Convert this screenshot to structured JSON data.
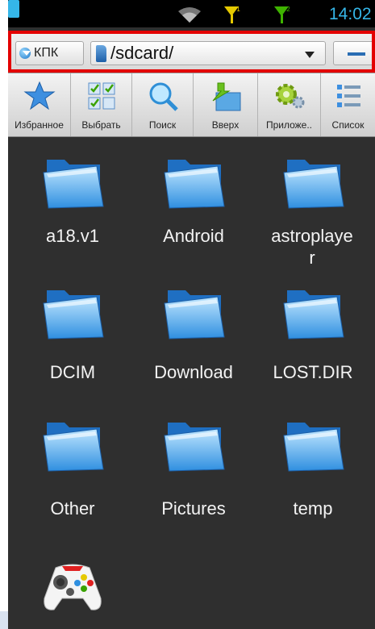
{
  "status_bar": {
    "time": "14:02"
  },
  "path_bar": {
    "kpk_label": "КПК",
    "path": "/sdcard/"
  },
  "toolbar": {
    "items": [
      {
        "label": "Избранное",
        "icon": "star-icon"
      },
      {
        "label": "Выбрать",
        "icon": "select-grid-icon"
      },
      {
        "label": "Поиск",
        "icon": "search-icon"
      },
      {
        "label": "Вверх",
        "icon": "folder-up-icon"
      },
      {
        "label": "Приложе..",
        "icon": "gear-icon"
      },
      {
        "label": "Список",
        "icon": "list-icon"
      }
    ]
  },
  "files": [
    {
      "name": "a18.v1",
      "type": "folder"
    },
    {
      "name": "Android",
      "type": "folder"
    },
    {
      "name": "astroplaye\nr",
      "type": "folder"
    },
    {
      "name": "DCIM",
      "type": "folder"
    },
    {
      "name": "Download",
      "type": "folder"
    },
    {
      "name": "LOST.DIR",
      "type": "folder"
    },
    {
      "name": "Other",
      "type": "folder"
    },
    {
      "name": "Pictures",
      "type": "folder"
    },
    {
      "name": "temp",
      "type": "folder"
    },
    {
      "name": "",
      "type": "gamepad-icon"
    }
  ],
  "colors": {
    "accent": "#35b6e8",
    "highlight": "#e30000",
    "background": "#2f2f2f"
  }
}
